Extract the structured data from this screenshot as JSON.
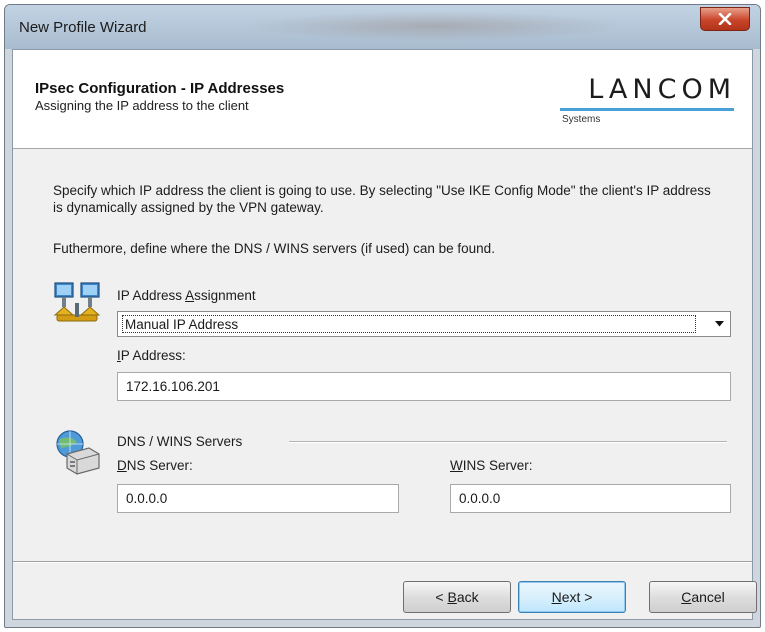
{
  "window": {
    "title": "New Profile Wizard",
    "close_glyph": "x"
  },
  "header": {
    "title": "IPsec Configuration - IP Addresses",
    "subtitle": "Assigning the IP address to the client",
    "logo_word": "LANCOM",
    "logo_sub": "Systems",
    "accent_color": "#4aa0d8"
  },
  "body": {
    "intro": "Specify which IP address the client is going to use. By selecting \"Use IKE Config Mode\" the client's IP address is dynamically assigned by the VPN gateway.",
    "dns_note": "Futhermore, define where the DNS / WINS servers (if used) can be found."
  },
  "ip_assignment": {
    "icon": "network-computers-icon",
    "label_pre": "IP Address ",
    "label_ul": "A",
    "label_post": "ssignment",
    "selected": "Manual IP Address",
    "ip_label_ul": "I",
    "ip_label_rest": "P Address:",
    "ip_value": "172.16.106.201"
  },
  "servers": {
    "icon": "globe-server-icon",
    "group_label": "DNS / WINS Servers",
    "dns_label_ul": "D",
    "dns_label_rest": "NS Server:",
    "dns_value": "0.0.0.0",
    "wins_label_ul": "W",
    "wins_label_rest": "INS Server:",
    "wins_value": "0.0.0.0"
  },
  "buttons": {
    "back_pre": "< ",
    "back_ul": "B",
    "back_rest": "ack",
    "next_pre": "",
    "next_ul": "N",
    "next_rest": "ext >",
    "cancel_ul": "C",
    "cancel_rest": "ancel"
  }
}
